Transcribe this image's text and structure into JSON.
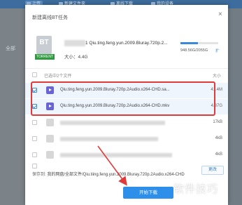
{
  "toolbar": {
    "upload_label": "上传",
    "new_folder_label": "新建文件夹",
    "offline_download_label": "离线下载",
    "my_devices_label": "我的设备"
  },
  "sidebar": {
    "all_files_label": "全部"
  },
  "dialog": {
    "title": "新建离线BT任务",
    "close_glyph": "×",
    "torrent": {
      "icon_text": "BT",
      "badge": "TORRENT",
      "name": "1 Qiu.ting.feng.yun.2009.Bluray.720p.2...",
      "size_label": "大小：",
      "size_value": "4.4G"
    },
    "disk": {
      "usage": "948.56G/2055G",
      "fraction": 0.46,
      "expand_label": "扩"
    },
    "list_header": {
      "selected_label": "已选中2个文件",
      "size_header": "大小"
    },
    "files": [
      {
        "name": "Qiu.ting.feng.yun.2009.Bluray.720p.2Audio.x264-CHD.sa...",
        "size": "41.4M",
        "checked": true,
        "type": "video"
      },
      {
        "name": "Qiu.ting.feng.yun.2009.Bluray.720p.2Audio.x264-CHD.mkv",
        "size": "4.37G",
        "checked": true,
        "type": "video"
      },
      {
        "name": "",
        "size": "17kB",
        "checked": false,
        "type": "file"
      },
      {
        "name": "",
        "size": "4kB",
        "checked": false,
        "type": "file"
      },
      {
        "name": "",
        "size": "4kB",
        "checked": false,
        "type": "file"
      }
    ],
    "save_label": "保存到:",
    "save_path": "我的网盘/全部文件/Qiu.tiing.feng.yun.2009.Bluray.720p.2Audio.x264-CHD",
    "change_label": "更改",
    "start_label": "开始下载"
  },
  "watermark": "软件技巧",
  "colors": {
    "accent": "#2d8fea",
    "highlight": "#e03b3b",
    "torrent_badge": "#2e9b3f",
    "video_icon": "#6a63d8"
  }
}
